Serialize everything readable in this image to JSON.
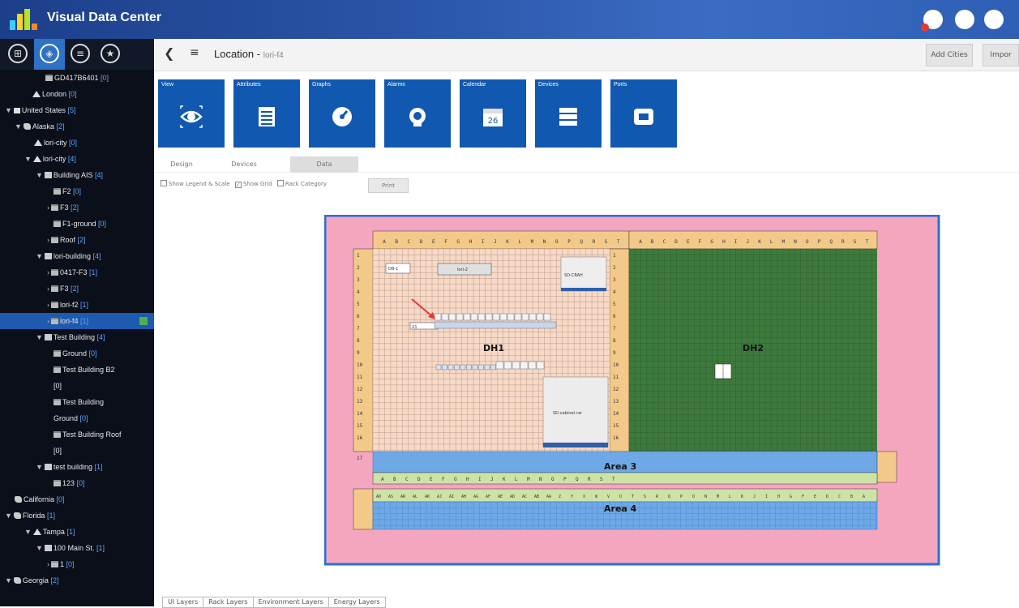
{
  "app": {
    "title": "Visual Data Center"
  },
  "sidebar": {
    "tabs": [
      "⊞",
      "◈",
      "≡",
      "★"
    ],
    "tree": [
      {
        "label": "GD417B6401",
        "count": "[0]",
        "indent": 56,
        "icon": "flr",
        "arrow": ""
      },
      {
        "label": "London",
        "count": "[0]",
        "indent": 40,
        "icon": "tri",
        "arrow": ""
      },
      {
        "label": "United States",
        "count": "[5]",
        "indent": 6,
        "icon": "flag",
        "arrow": "▼"
      },
      {
        "label": "Alaska",
        "count": "[2]",
        "indent": 18,
        "icon": "state",
        "arrow": "▼"
      },
      {
        "label": "lori-city",
        "count": "[0]",
        "indent": 42,
        "icon": "tri",
        "arrow": ""
      },
      {
        "label": "lori-city",
        "count": "[4]",
        "indent": 30,
        "icon": "tri",
        "arrow": "▼"
      },
      {
        "label": "Building AIS",
        "count": "[4]",
        "indent": 44,
        "icon": "bld",
        "arrow": "▼"
      },
      {
        "label": "F2",
        "count": "[0]",
        "indent": 66,
        "icon": "flr",
        "arrow": ""
      },
      {
        "label": "F3",
        "count": "[2]",
        "indent": 58,
        "icon": "flr",
        "arrow": "›"
      },
      {
        "label": "F1-ground",
        "count": "[0]",
        "indent": 66,
        "icon": "flr",
        "arrow": ""
      },
      {
        "label": "Roof",
        "count": "[2]",
        "indent": 58,
        "icon": "flr",
        "arrow": "›"
      },
      {
        "label": "lori-building",
        "count": "[4]",
        "indent": 44,
        "icon": "bld",
        "arrow": "▼"
      },
      {
        "label": "0417-F3",
        "count": "[1]",
        "indent": 58,
        "icon": "flr",
        "arrow": "›"
      },
      {
        "label": "F3",
        "count": "[2]",
        "indent": 58,
        "icon": "flr",
        "arrow": "›"
      },
      {
        "label": "lori-f2",
        "count": "[1]",
        "indent": 58,
        "icon": "flr",
        "arrow": "›"
      },
      {
        "label": "lori-f4",
        "count": "[1]",
        "indent": 58,
        "icon": "flr",
        "arrow": "›",
        "selected": true
      },
      {
        "label": "Test Building",
        "count": "[4]",
        "indent": 44,
        "icon": "bld",
        "arrow": "▼"
      },
      {
        "label": "Ground",
        "count": "[0]",
        "indent": 66,
        "icon": "flr",
        "arrow": ""
      },
      {
        "label": "Test Building B2",
        "count": "",
        "indent": 66,
        "icon": "flr",
        "arrow": ""
      },
      {
        "label": "[0]",
        "count": "",
        "indent": 66,
        "icon": "",
        "arrow": ""
      },
      {
        "label": "Test Building",
        "count": "",
        "indent": 66,
        "icon": "flr",
        "arrow": ""
      },
      {
        "label": "Ground",
        "count": "[0]",
        "indent": 66,
        "icon": "",
        "arrow": ""
      },
      {
        "label": "Test Building Roof",
        "count": "",
        "indent": 66,
        "icon": "flr",
        "arrow": ""
      },
      {
        "label": "[0]",
        "count": "",
        "indent": 66,
        "icon": "",
        "arrow": ""
      },
      {
        "label": "test building",
        "count": "[1]",
        "indent": 44,
        "icon": "bld",
        "arrow": "▼"
      },
      {
        "label": "123",
        "count": "[0]",
        "indent": 66,
        "icon": "flr",
        "arrow": ""
      },
      {
        "label": "California",
        "count": "[0]",
        "indent": 18,
        "icon": "state",
        "arrow": ""
      },
      {
        "label": "Florida",
        "count": "[1]",
        "indent": 6,
        "icon": "state",
        "arrow": "▼"
      },
      {
        "label": "Tampa",
        "count": "[1]",
        "indent": 30,
        "icon": "tri",
        "arrow": "▼"
      },
      {
        "label": "100 Main St.",
        "count": "[1]",
        "indent": 44,
        "icon": "bld",
        "arrow": "▼"
      },
      {
        "label": "1",
        "count": "[0]",
        "indent": 58,
        "icon": "flr",
        "arrow": "›"
      },
      {
        "label": "Georgia",
        "count": "[2]",
        "indent": 6,
        "icon": "state",
        "arrow": "▼"
      }
    ]
  },
  "header": {
    "title": "Location",
    "subtitle": "lori-f4",
    "buttons": [
      "Add Cities",
      "Impor"
    ]
  },
  "tiles": [
    {
      "label": "View",
      "icon": "eye-icon",
      "active": true
    },
    {
      "label": "Attributes",
      "icon": "list-icon"
    },
    {
      "label": "Graphs",
      "icon": "gauge-icon"
    },
    {
      "label": "Alarms",
      "icon": "alarm-icon"
    },
    {
      "label": "Calendar",
      "icon": "calendar-icon",
      "day": "26"
    },
    {
      "label": "Devices",
      "icon": "server-icon"
    },
    {
      "label": "Ports",
      "icon": "port-icon"
    }
  ],
  "tabs": [
    "Design",
    "Devices",
    "Data"
  ],
  "options": {
    "legend": "Show Legend & Scale",
    "grid": "Show Grid",
    "rack": "Rack Category",
    "print": "Print"
  },
  "map": {
    "rooms": [
      {
        "label": "DH1"
      },
      {
        "label": "DH2"
      },
      {
        "label": "Area 3"
      },
      {
        "label": "Area 4"
      }
    ],
    "devices": {
      "crac": "SD-CRAH",
      "cabinet": "SD-cabinet rar",
      "lori2": "lori-2",
      "r1": "DB-1",
      "r2": "X1"
    },
    "col_letters": [
      "A",
      "B",
      "C",
      "D",
      "E",
      "F",
      "G",
      "H",
      "I",
      "J",
      "K",
      "L",
      "M",
      "N",
      "O",
      "P",
      "Q",
      "R",
      "S",
      "T"
    ],
    "area4_letters": [
      "AD",
      "AS",
      "AR",
      "AL",
      "AK",
      "AJ",
      "AI",
      "AH",
      "AG",
      "AF",
      "AE",
      "AD",
      "AC",
      "AB",
      "AA",
      "Z",
      "Y",
      "X",
      "W",
      "V",
      "U",
      "T",
      "S",
      "R",
      "Q",
      "P",
      "O",
      "N",
      "M",
      "L",
      "K",
      "J",
      "I",
      "H",
      "G",
      "F",
      "E",
      "D",
      "C",
      "B",
      "A"
    ],
    "row_numbers": [
      "1",
      "2",
      "3",
      "4",
      "5",
      "6",
      "7",
      "8",
      "9",
      "10",
      "11",
      "12",
      "13",
      "14",
      "15",
      "16",
      "17"
    ],
    "colors": {
      "bg_pink": "#f5a6bf",
      "border_blue": "#2a6fd6",
      "ruler": "#f3c98a",
      "dh1": "#f6d9c6",
      "dh2": "#3e7a3e",
      "area3": "#6fa8e6",
      "area4": "#cde3a6"
    }
  },
  "bottom_tabs": [
    "UI Layers",
    "Rack Layers",
    "Environment Layers",
    "Energy Layers"
  ]
}
